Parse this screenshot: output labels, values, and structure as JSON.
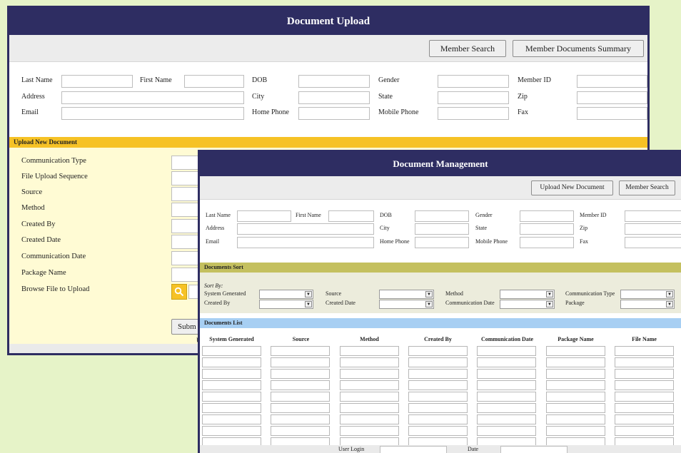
{
  "upload_window": {
    "title": "Document Upload",
    "buttons": {
      "member_search": "Member Search",
      "member_docs_summary": "Member Documents Summary"
    },
    "member": {
      "last_name": "Last Name",
      "first_name": "First Name",
      "dob": "DOB",
      "gender": "Gender",
      "member_id": "Member ID",
      "address": "Address",
      "city": "City",
      "state": "State",
      "zip": "Zip",
      "email": "Email",
      "home_phone": "Home Phone",
      "mobile_phone": "Mobile Phone",
      "fax": "Fax"
    },
    "section_title": "Upload New Document",
    "fields": [
      "Communication Type",
      "File Upload Sequence",
      "Source",
      "Method",
      "Created By",
      "Created Date",
      "Communication Date",
      "Package Name",
      "Browse File to Upload"
    ],
    "submit_label": "Subm",
    "footer_fragment": "U"
  },
  "management_window": {
    "title": "Document Management",
    "buttons": {
      "upload_new": "Upload New Document",
      "member_search": "Member Search"
    },
    "member": {
      "last_name": "Last Name",
      "first_name": "First Name",
      "dob": "DOB",
      "gender": "Gender",
      "member_id": "Member ID",
      "address": "Address",
      "city": "City",
      "state": "State",
      "zip": "Zip",
      "email": "Email",
      "home_phone": "Home Phone",
      "mobile_phone": "Mobile Phone",
      "fax": "Fax"
    },
    "sort": {
      "title": "Documents Sort",
      "sort_by": "Sort By:",
      "labels": {
        "system_generated": "System Generated",
        "source": "Source",
        "method": "Method",
        "communication_type": "Communication Type",
        "created_by": "Created By",
        "created_date": "Created Date",
        "communication_date": "Communication Date",
        "package": "Package"
      }
    },
    "list": {
      "title": "Documents List",
      "columns": [
        "System Generated",
        "Source",
        "Method",
        "Created By",
        "Communication Date",
        "Package Name",
        "File Name"
      ]
    },
    "footer": {
      "user_login": "User Login",
      "date": "Date"
    }
  },
  "colors": {
    "title_bar": "#2e2d62",
    "upload_section": "#f6c225",
    "upload_area": "#fffbd4",
    "sort_section": "#c4c05f",
    "list_section": "#a7cff3",
    "page_background": "#e6f3c8"
  },
  "icons": {
    "browse": "search-icon",
    "dropdown": "chevron-down-icon"
  }
}
